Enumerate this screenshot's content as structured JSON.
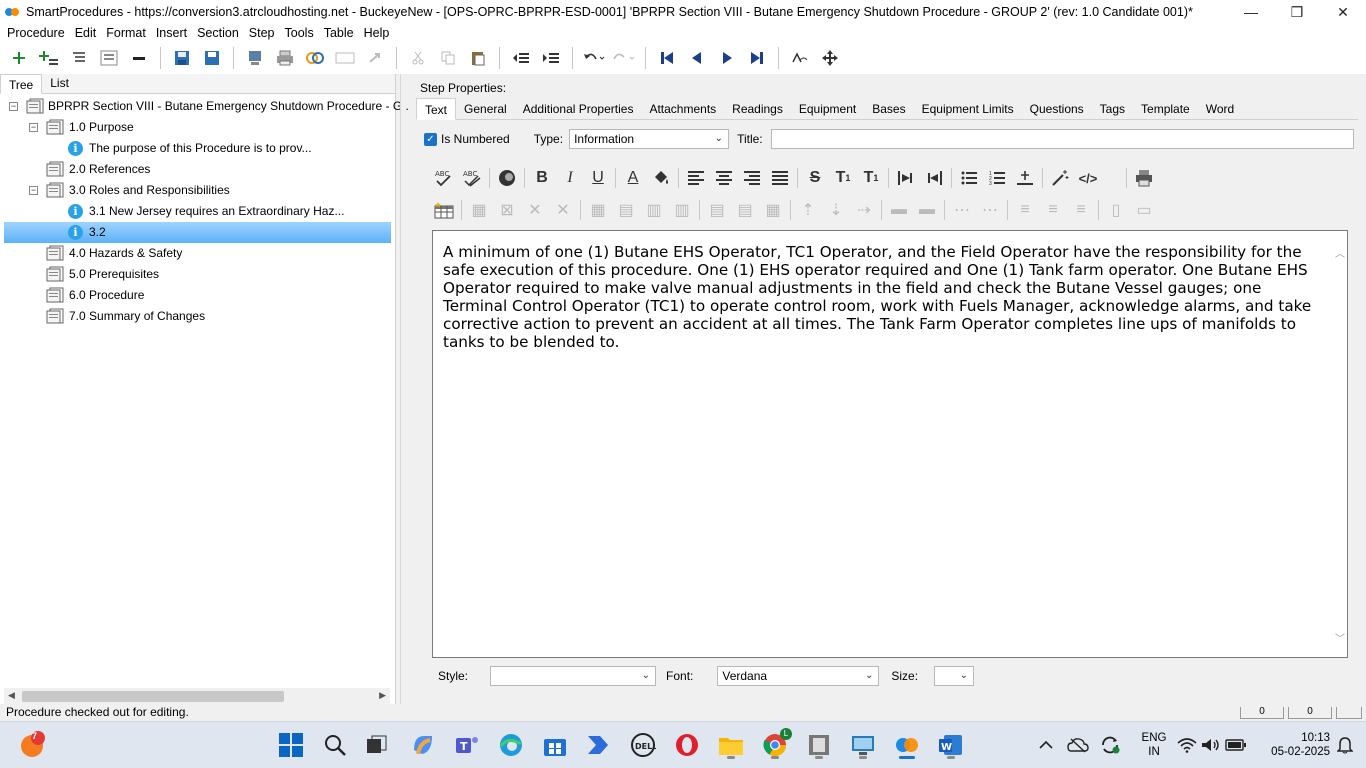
{
  "window": {
    "title": "SmartProcedures - https://conversion3.atrcloudhosting.net - BuckeyeNew - [OPS-OPRC-BPRPR-ESD-0001] 'BPRPR Section VIII - Butane Emergency Shutdown Procedure - GROUP 2' (rev: 1.0 Candidate 001)*",
    "minimize": "—",
    "maximize": "❒",
    "close": "✕"
  },
  "menu": [
    {
      "label": "Procedure"
    },
    {
      "label": "Edit"
    },
    {
      "label": "Format"
    },
    {
      "label": "Insert"
    },
    {
      "label": "Section"
    },
    {
      "label": "Step"
    },
    {
      "label": "Tools"
    },
    {
      "label": "Table"
    },
    {
      "label": "Help"
    }
  ],
  "left_panel": {
    "tabs": [
      "Tree",
      "List"
    ],
    "tree": [
      {
        "label": "BPRPR Section VIII - Butane Emergency Shutdown Procedure - G..."
      },
      {
        "label": "1.0 Purpose"
      },
      {
        "label": "The purpose of this Procedure is to prov..."
      },
      {
        "label": "2.0 References"
      },
      {
        "label": "3.0 Roles and Responsibilities"
      },
      {
        "label": "3.1 New Jersey requires an Extraordinary Haz..."
      },
      {
        "label": "3.2"
      },
      {
        "label": "4.0 Hazards & Safety"
      },
      {
        "label": "5.0 Prerequisites"
      },
      {
        "label": "6.0 Procedure"
      },
      {
        "label": "7.0 Summary of Changes"
      }
    ]
  },
  "step_properties": {
    "label": "Step Properties:",
    "tabs": [
      "Text",
      "General",
      "Additional Properties",
      "Attachments",
      "Readings",
      "Equipment",
      "Bases",
      "Equipment Limits",
      "Questions",
      "Tags",
      "Template",
      "Word"
    ],
    "is_numbered_label": "Is Numbered",
    "type_label": "Type:",
    "type_value": "Information",
    "title_label": "Title:",
    "title_value": "",
    "editor_text": "A minimum of one (1) Butane EHS Operator, TC1 Operator, and the Field Operator have the responsibility for the safe execution of this procedure. One (1) EHS operator required and One (1) Tank farm operator. One Butane EHS Operator required to make valve manual adjustments in the field and check the Butane Vessel gauges; one Terminal Control Operator (TC1) to operate control room, work with Fuels Manager, acknowledge alarms, and take corrective action to prevent an accident at all times. The Tank Farm Operator completes line ups of manifolds to tanks to be blended to.",
    "style_label": "Style:",
    "style_value": "",
    "font_label": "Font:",
    "font_value": "Verdana",
    "size_label": "Size:",
    "size_value": ""
  },
  "status": {
    "text": "Procedure checked out for editing.",
    "box1": "0",
    "box2": "0"
  },
  "taskbar": {
    "weather_badge": "7",
    "chrome_badge": "L",
    "lang_line1": "ENG",
    "lang_line2": "IN",
    "time": "10:13",
    "date": "05-02-2025"
  },
  "colors": {
    "selection": "#5cb2f5",
    "info_icon": "#2aa3e6",
    "accent": "#1a73c8"
  }
}
